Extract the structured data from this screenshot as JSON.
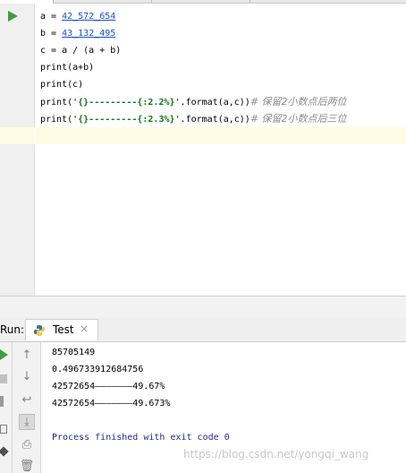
{
  "editor": {
    "lines": [
      {
        "parts": [
          {
            "t": "a = ",
            "c": ""
          },
          {
            "t": "42_572_654",
            "c": "num"
          }
        ]
      },
      {
        "parts": [
          {
            "t": "b = ",
            "c": ""
          },
          {
            "t": "43_132_495",
            "c": "num"
          }
        ]
      },
      {
        "parts": [
          {
            "t": "c = a / (a + b)",
            "c": ""
          }
        ]
      },
      {
        "parts": [
          {
            "t": "print(a+b)",
            "c": ""
          }
        ]
      },
      {
        "parts": [
          {
            "t": "print(c)",
            "c": ""
          }
        ]
      },
      {
        "parts": [
          {
            "t": "print(",
            "c": ""
          },
          {
            "t": "'{}---------{:2.2%}'",
            "c": "str"
          },
          {
            "t": ".format(a,c))",
            "c": ""
          },
          {
            "t": "# 保留2小数点后两位",
            "c": "cmt"
          }
        ]
      },
      {
        "parts": [
          {
            "t": "print(",
            "c": ""
          },
          {
            "t": "'{}---------{:2.3%}'",
            "c": "str"
          },
          {
            "t": ".format(a,c))",
            "c": ""
          },
          {
            "t": "# 保留2小数点后三位",
            "c": "cmt"
          }
        ]
      }
    ]
  },
  "run_panel": {
    "label": "Run:",
    "tab_label": "Test",
    "tab_close": "×"
  },
  "console": {
    "lines": [
      "85705149",
      "0.496733912684756",
      "42572654———————49.67%",
      "42572654———————49.673%",
      "",
      "Process finished with exit code 0"
    ]
  },
  "watermark": "https://blog.csdn.net/yongqi_wang"
}
